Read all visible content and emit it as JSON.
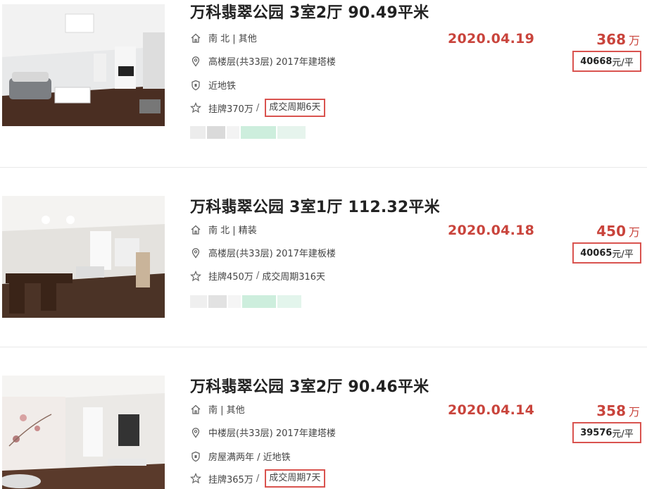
{
  "listings": [
    {
      "title": "万科翡翠公园 3室2厅 90.49平米",
      "orientation": "南 北 | 其他",
      "floor": "高楼层(共33层) 2017年建塔楼",
      "tag": "近地铁",
      "listed": "挂牌370万",
      "cycle": "成交周期6天",
      "date": "2020.04.19",
      "price": "368",
      "price_unit": "万",
      "unit_price_value": "40668",
      "unit_price_suffix": "元/平"
    },
    {
      "title": "万科翡翠公园 3室1厅 112.32平米",
      "orientation": "南 北 | 精装",
      "floor": "高楼层(共33层) 2017年建板楼",
      "listed": "挂牌450万",
      "cycle": "成交周期316天",
      "date": "2020.04.18",
      "price": "450",
      "price_unit": "万",
      "unit_price_value": "40065",
      "unit_price_suffix": "元/平"
    },
    {
      "title": "万科翡翠公园 3室2厅 90.46平米",
      "orientation": "南 | 其他",
      "floor": "中楼层(共33层) 2017年建塔楼",
      "tag": "房屋满两年 / 近地铁",
      "listed": "挂牌365万",
      "cycle": "成交周期7天",
      "date": "2020.04.14",
      "price": "358",
      "price_unit": "万",
      "unit_price_value": "39576",
      "unit_price_suffix": "元/平"
    }
  ],
  "separator": "/",
  "colors": {
    "accent": "#c9443c",
    "box": "#d9534f",
    "text": "#222222",
    "muted": "#444444"
  },
  "icons": {
    "orientation": "house-icon",
    "floor": "location-pin-icon",
    "tag": "shield-icon",
    "listed": "star-icon"
  }
}
